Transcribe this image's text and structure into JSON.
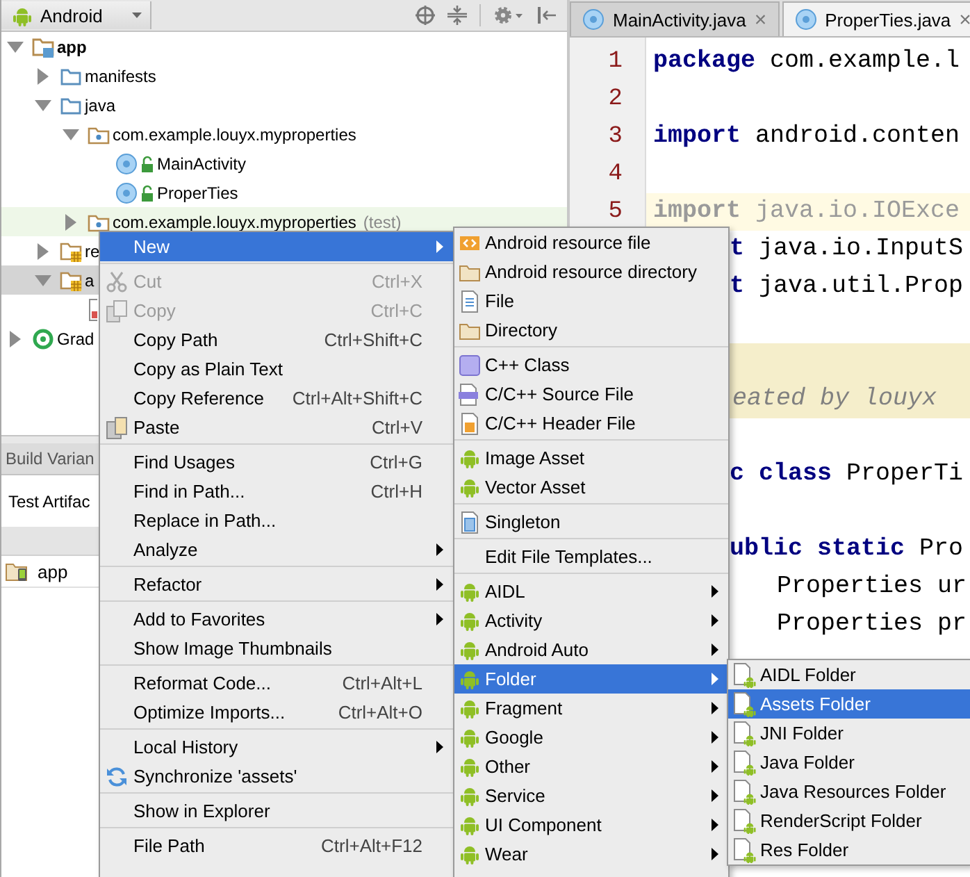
{
  "toolbar": {
    "view": "Android"
  },
  "tree": [
    {
      "label": "app",
      "kind": "module",
      "expanded": true,
      "selected": false,
      "children": [
        {
          "label": "manifests",
          "kind": "folder",
          "expanded": false,
          "selected": false
        },
        {
          "label": "java",
          "kind": "folder",
          "expanded": true,
          "selected": false,
          "children": [
            {
              "label": "com.example.louyx.myproperties",
              "kind": "package",
              "expanded": true,
              "selected": false,
              "children": [
                {
                  "label": "MainActivity",
                  "kind": "class",
                  "selected": false
                },
                {
                  "label": "ProperTies",
                  "kind": "class",
                  "selected": false
                }
              ]
            },
            {
              "label": "com.example.louyx.myproperties",
              "suffix": "(test)",
              "kind": "test-package",
              "expanded": false,
              "selected": false
            }
          ]
        },
        {
          "label": "re",
          "kind": "res-folder",
          "expanded": false,
          "selected": false
        },
        {
          "label": "a",
          "kind": "res-folder",
          "expanded": true,
          "selected": true,
          "children": [
            {
              "kind": "file",
              "selected": false
            }
          ]
        }
      ]
    },
    {
      "label": "Grad",
      "kind": "gradle",
      "expanded": false,
      "selected": false
    }
  ],
  "build_variants": {
    "title": "Build Varian",
    "test_artifact": "Test Artifac",
    "modules": [
      {
        "name": "app"
      }
    ]
  },
  "editor": {
    "tabs": [
      {
        "label": "MainActivity.java",
        "close": "×",
        "selected": false
      },
      {
        "label": "ProperTies.java",
        "close": "×",
        "selected": true
      }
    ],
    "lines": [
      {
        "number": "1",
        "kind": "code",
        "text": "**package** com.example.l",
        "current": false
      },
      {
        "number": "2",
        "kind": "blank",
        "current": false
      },
      {
        "number": "3",
        "kind": "code",
        "text": "**import** android.conten",
        "current": false
      },
      {
        "number": "4",
        "kind": "blank",
        "current": false
      },
      {
        "number": "5",
        "kind": "unused",
        "text": "**import** java.io.IOExce",
        "current": true
      },
      {
        "kind": "covered",
        "text": "**t** java.io.InputS",
        "current": false
      },
      {
        "kind": "covered",
        "text": "**t** java.util.Prop",
        "current": false
      },
      {
        "kind": "blank",
        "current": false
      },
      {
        "kind": "doc-blank",
        "current": false
      },
      {
        "kind": "doc",
        "text": "eated by louyx",
        "current": false
      },
      {
        "kind": "blank",
        "current": false
      },
      {
        "kind": "covered",
        "text": "**c class** ProperTi",
        "current": false
      },
      {
        "kind": "blank",
        "current": false
      },
      {
        "kind": "covered",
        "text": "**ublic static** Pro",
        "current": false
      },
      {
        "kind": "covered-indented",
        "text": "Properties ur",
        "current": false
      },
      {
        "kind": "covered-indented",
        "text": "Properties pr",
        "current": false
      }
    ]
  },
  "context_menu": [
    {
      "kind": "item",
      "label": "New",
      "submenu": true,
      "selected": true,
      "disabled": false
    },
    {
      "kind": "separator"
    },
    {
      "kind": "item",
      "label": "Cut",
      "shortcut": "Ctrl+X",
      "submenu": false,
      "selected": false,
      "disabled": true
    },
    {
      "kind": "item",
      "label": "Copy",
      "shortcut": "Ctrl+C",
      "submenu": false,
      "selected": false,
      "disabled": true
    },
    {
      "kind": "item",
      "label": "Copy Path",
      "shortcut": "Ctrl+Shift+C",
      "submenu": false,
      "selected": false,
      "disabled": false
    },
    {
      "kind": "item",
      "label": "Copy as Plain Text",
      "submenu": false,
      "selected": false,
      "disabled": false
    },
    {
      "kind": "item",
      "label": "Copy Reference",
      "shortcut": "Ctrl+Alt+Shift+C",
      "submenu": false,
      "selected": false,
      "disabled": false
    },
    {
      "kind": "item",
      "label": "Paste",
      "shortcut": "Ctrl+V",
      "submenu": false,
      "selected": false,
      "disabled": false
    },
    {
      "kind": "separator"
    },
    {
      "kind": "item",
      "label": "Find Usages",
      "shortcut": "Ctrl+G",
      "submenu": false,
      "selected": false,
      "disabled": false
    },
    {
      "kind": "item",
      "label": "Find in Path...",
      "shortcut": "Ctrl+H",
      "submenu": false,
      "selected": false,
      "disabled": false
    },
    {
      "kind": "item",
      "label": "Replace in Path...",
      "submenu": false,
      "selected": false,
      "disabled": false
    },
    {
      "kind": "item",
      "label": "Analyze",
      "submenu": true,
      "selected": false,
      "disabled": false
    },
    {
      "kind": "separator"
    },
    {
      "kind": "item",
      "label": "Refactor",
      "submenu": true,
      "selected": false,
      "disabled": false
    },
    {
      "kind": "separator"
    },
    {
      "kind": "item",
      "label": "Add to Favorites",
      "submenu": true,
      "selected": false,
      "disabled": false
    },
    {
      "kind": "item",
      "label": "Show Image Thumbnails",
      "submenu": false,
      "selected": false,
      "disabled": false
    },
    {
      "kind": "separator"
    },
    {
      "kind": "item",
      "label": "Reformat Code...",
      "shortcut": "Ctrl+Alt+L",
      "submenu": false,
      "selected": false,
      "disabled": false
    },
    {
      "kind": "item",
      "label": "Optimize Imports...",
      "shortcut": "Ctrl+Alt+O",
      "submenu": false,
      "selected": false,
      "disabled": false
    },
    {
      "kind": "separator"
    },
    {
      "kind": "item",
      "label": "Local History",
      "submenu": true,
      "selected": false,
      "disabled": false
    },
    {
      "kind": "item",
      "label": "Synchronize 'assets'",
      "submenu": false,
      "selected": false,
      "disabled": false
    },
    {
      "kind": "separator"
    },
    {
      "kind": "item",
      "label": "Show in Explorer",
      "submenu": false,
      "selected": false,
      "disabled": false
    },
    {
      "kind": "separator"
    },
    {
      "kind": "item",
      "label": "File Path",
      "shortcut": "Ctrl+Alt+F12",
      "submenu": false,
      "selected": false,
      "disabled": false
    }
  ],
  "new_menu": [
    {
      "kind": "item",
      "label": "Android resource file",
      "submenu": false,
      "selected": false,
      "disabled": false
    },
    {
      "kind": "item",
      "label": "Android resource directory",
      "submenu": false,
      "selected": false,
      "disabled": false
    },
    {
      "kind": "item",
      "label": "File",
      "submenu": false,
      "selected": false,
      "disabled": false
    },
    {
      "kind": "item",
      "label": "Directory",
      "submenu": false,
      "selected": false,
      "disabled": false
    },
    {
      "kind": "separator"
    },
    {
      "kind": "item",
      "label": "C++ Class",
      "submenu": false,
      "selected": false,
      "disabled": false
    },
    {
      "kind": "item",
      "label": "C/C++ Source File",
      "submenu": false,
      "selected": false,
      "disabled": false
    },
    {
      "kind": "item",
      "label": "C/C++ Header File",
      "submenu": false,
      "selected": false,
      "disabled": false
    },
    {
      "kind": "separator"
    },
    {
      "kind": "item",
      "label": "Image Asset",
      "submenu": false,
      "selected": false,
      "disabled": false
    },
    {
      "kind": "item",
      "label": "Vector Asset",
      "submenu": false,
      "selected": false,
      "disabled": false
    },
    {
      "kind": "separator"
    },
    {
      "kind": "item",
      "label": "Singleton",
      "submenu": false,
      "selected": false,
      "disabled": false
    },
    {
      "kind": "separator"
    },
    {
      "kind": "item",
      "label": "Edit File Templates...",
      "submenu": false,
      "selected": false,
      "disabled": false
    },
    {
      "kind": "separator"
    },
    {
      "kind": "item",
      "label": "AIDL",
      "submenu": true,
      "selected": false,
      "disabled": false
    },
    {
      "kind": "item",
      "label": "Activity",
      "submenu": true,
      "selected": false,
      "disabled": false
    },
    {
      "kind": "item",
      "label": "Android Auto",
      "submenu": true,
      "selected": false,
      "disabled": false
    },
    {
      "kind": "item",
      "label": "Folder",
      "submenu": true,
      "selected": true,
      "disabled": false
    },
    {
      "kind": "item",
      "label": "Fragment",
      "submenu": true,
      "selected": false,
      "disabled": false
    },
    {
      "kind": "item",
      "label": "Google",
      "submenu": true,
      "selected": false,
      "disabled": false
    },
    {
      "kind": "item",
      "label": "Other",
      "submenu": true,
      "selected": false,
      "disabled": false
    },
    {
      "kind": "item",
      "label": "Service",
      "submenu": true,
      "selected": false,
      "disabled": false
    },
    {
      "kind": "item",
      "label": "UI Component",
      "submenu": true,
      "selected": false,
      "disabled": false
    },
    {
      "kind": "item",
      "label": "Wear",
      "submenu": true,
      "selected": false,
      "disabled": false
    }
  ],
  "folder_menu": [
    {
      "kind": "item",
      "label": "AIDL Folder",
      "submenu": false,
      "selected": false,
      "disabled": false
    },
    {
      "kind": "item",
      "label": "Assets Folder",
      "submenu": false,
      "selected": true,
      "disabled": false
    },
    {
      "kind": "item",
      "label": "JNI Folder",
      "submenu": false,
      "selected": false,
      "disabled": false
    },
    {
      "kind": "item",
      "label": "Java Folder",
      "submenu": false,
      "selected": false,
      "disabled": false
    },
    {
      "kind": "item",
      "label": "Java Resources Folder",
      "submenu": false,
      "selected": false,
      "disabled": false
    },
    {
      "kind": "item",
      "label": "RenderScript Folder",
      "submenu": false,
      "selected": false,
      "disabled": false
    },
    {
      "kind": "item",
      "label": "Res Folder",
      "submenu": false,
      "selected": false,
      "disabled": false
    }
  ]
}
